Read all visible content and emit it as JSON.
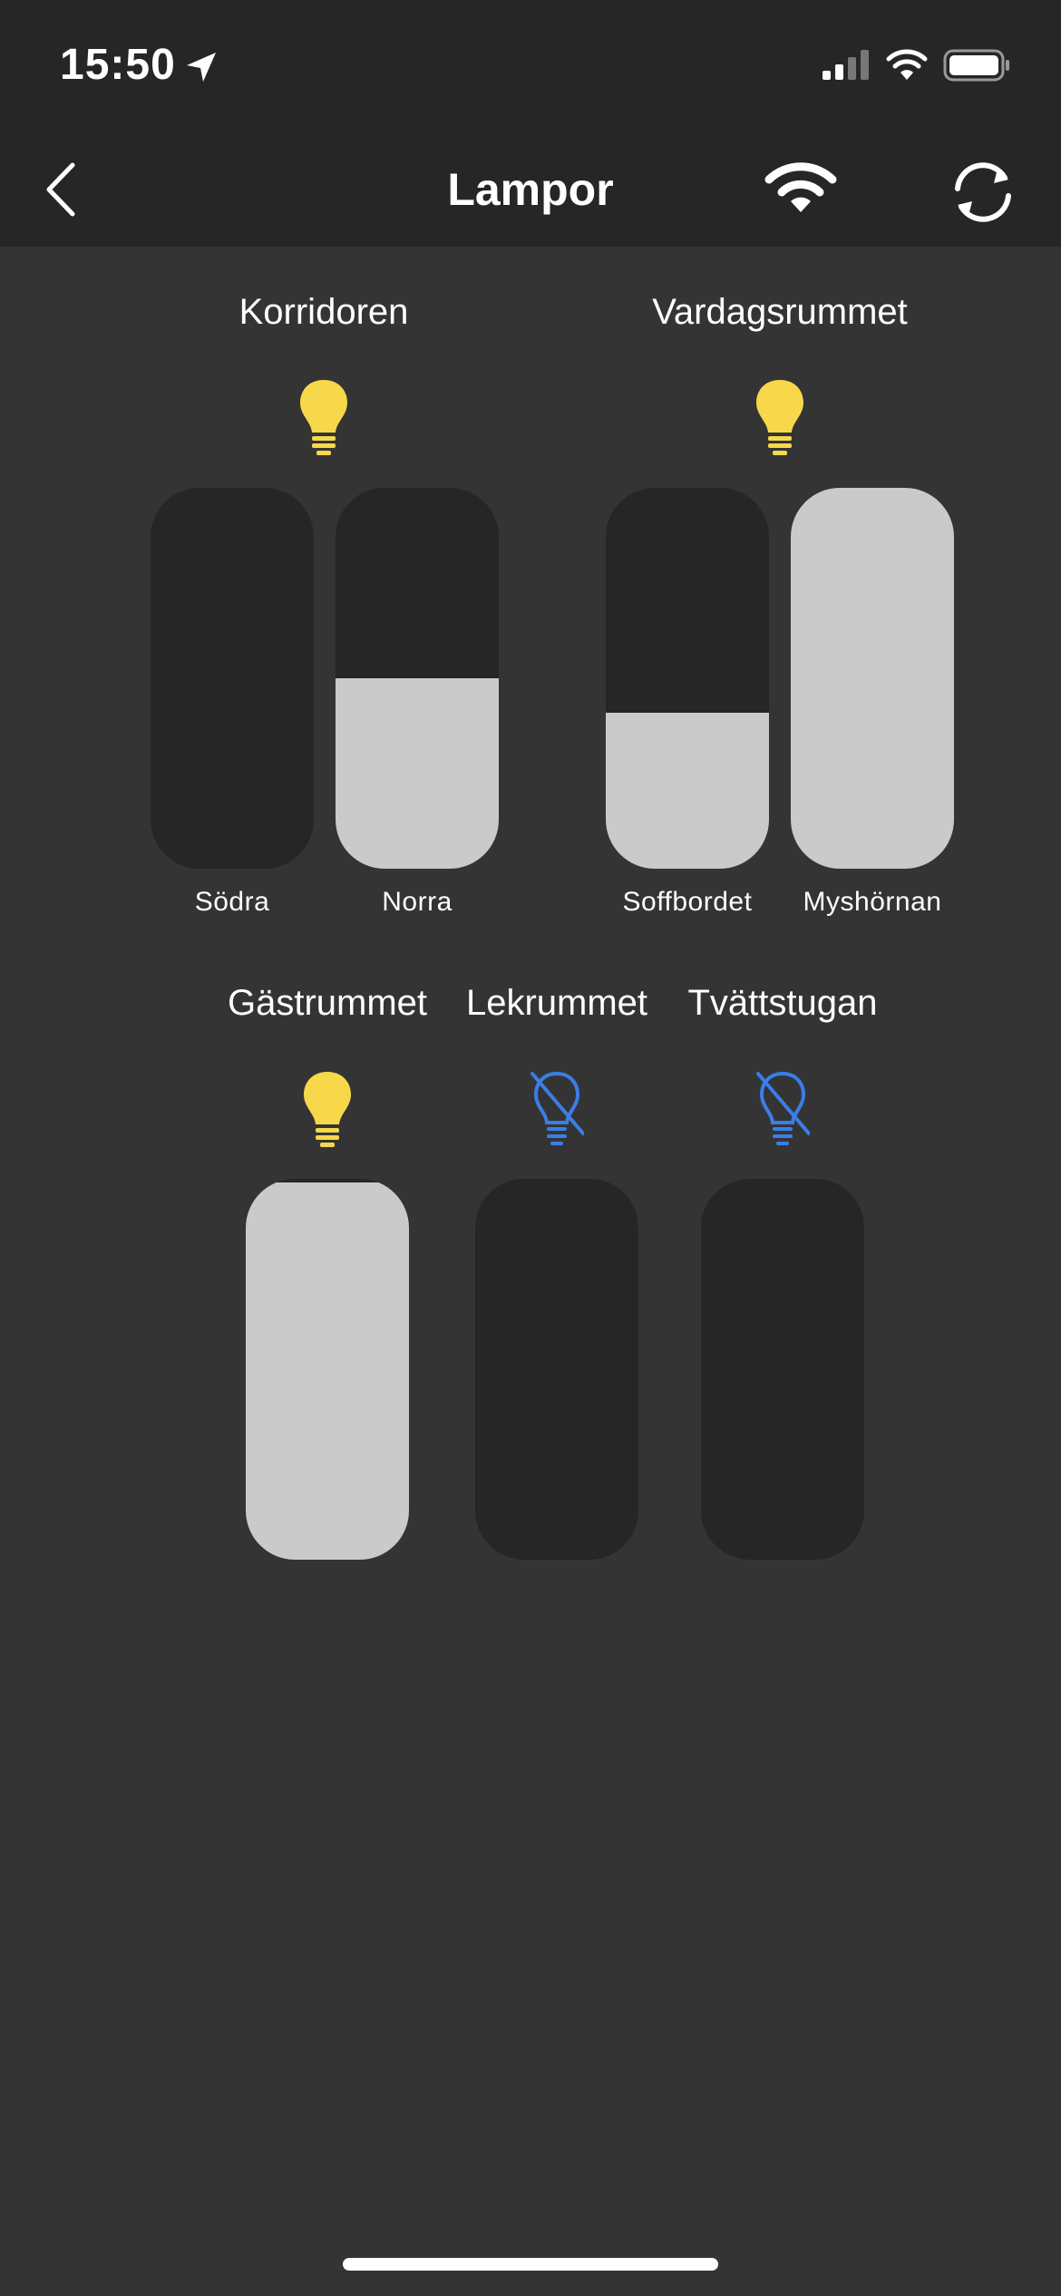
{
  "status_bar": {
    "time": "15:50"
  },
  "nav": {
    "title": "Lampor"
  },
  "colors": {
    "bulb_on": "#f7d84a",
    "bulb_off": "#3a7ee6",
    "slider_track": "#262626",
    "slider_fill": "#cacaca"
  },
  "groups": [
    {
      "title": "Korridoren",
      "bulb": "bulb-on-icon",
      "lights": [
        {
          "label": "Södra",
          "level": 0
        },
        {
          "label": "Norra",
          "level": 0.5
        }
      ]
    },
    {
      "title": "Vardagsrummet",
      "bulb": "bulb-on-icon",
      "lights": [
        {
          "label": "Soffbordet",
          "level": 0.41
        },
        {
          "label": "Myshörnan",
          "level": 1.0
        }
      ]
    },
    {
      "title": "Gästrummet",
      "bulb": "bulb-on-icon",
      "lights": [
        {
          "level": 0.99
        }
      ]
    },
    {
      "title": "Lekrummet",
      "bulb": "bulb-off-icon",
      "lights": [
        {
          "level": 0
        }
      ]
    },
    {
      "title": "Tvättstugan",
      "bulb": "bulb-off-icon",
      "lights": [
        {
          "level": 0
        }
      ]
    }
  ]
}
